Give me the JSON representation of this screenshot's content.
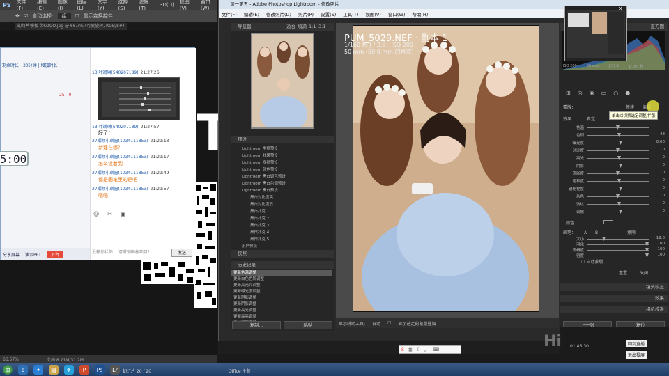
{
  "photoshop": {
    "logo": "PS",
    "menu": [
      "文件(F)",
      "编辑(E)",
      "图像(I)",
      "图层(L)",
      "文字(Y)",
      "选择(S)",
      "滤镜(T)",
      "3D(D)",
      "视图(V)",
      "窗口(W)"
    ],
    "options": {
      "auto_select": "自动选择:",
      "group": "组",
      "show_transform": "显示变换控件"
    },
    "tab": "幻灯片模板 带LOGO.jpg @ 66.7% (可变旋转, RGB/8#) *",
    "status_zoom": "66.67%",
    "status_doc": "文档:8.21M/31.2M",
    "big_letter": "T"
  },
  "chat": {
    "duration": "剩余时长：30分钟 | 增加时长",
    "badges": [
      "25",
      "0"
    ],
    "clock": "5:00",
    "bottom": {
      "share": "分享屏幕",
      "ppt": "演示PPT",
      "leave": "下台"
    },
    "messages": [
      {
        "user": "13 叶斌琳(540207189)",
        "time": "21:27:26",
        "text": "",
        "color": "orange"
      },
      {
        "user": "13 叶斌琳(540207189)",
        "time": "21:27:57",
        "text": "好了！",
        "color": "black"
      },
      {
        "user": "27姻颜小瑛窗(1034111853)",
        "time": "21:29:13",
        "text": "新建在哪？",
        "color": "orange"
      },
      {
        "user": "27姻颜小瑛窗(1034111853)",
        "time": "21:29:17",
        "text": "怎么设着到",
        "color": "orange"
      },
      {
        "user": "27姻颜小瑛窗(1034111853)",
        "time": "21:29:49",
        "text": "都是画笔里的是吧",
        "color": "orange"
      },
      {
        "user": "27姻颜小瑛窗(1034111853)",
        "time": "21:29:57",
        "text": "嗯嗯",
        "color": "orange"
      }
    ],
    "input_placeholder": "没被你拦你… 请撤销图标项目！",
    "send": "发送"
  },
  "lightroom": {
    "title": "课一第五 - Adobe Photoshop Lightroom - 修改照片",
    "menu": [
      "文件(F)",
      "编辑(E)",
      "修改照片(D)",
      "照片(P)",
      "设置(S)",
      "工具(T)",
      "视图(V)",
      "窗口(W)",
      "帮助(H)"
    ],
    "navigator": {
      "title": "导航器",
      "fit": "适合",
      "fill": "填满",
      "ratio": "1:1",
      "ratio2": "3:1"
    },
    "presets_title": "预设",
    "presets": [
      "Lightroom 常规预设",
      "Lightroom 效果预设",
      "Lightroom 视频预设",
      "Lightroom 颜色预设",
      "Lightroom 黑白调色预设",
      "Lightroom 黑白色调预设",
      "Lightroom 黑白预设"
    ],
    "sub_presets": [
      "黑白对比度高",
      "黑白对比度低",
      "黑白扑克 1",
      "黑白扑克 2",
      "黑白扑克 3",
      "黑白扑克 4",
      "黑白扑克 5"
    ],
    "user_presets": "用户预设",
    "snapshots_title": "快照",
    "history_title": "历史记录",
    "history": [
      "更新色温调整",
      "更新白色色阶调整",
      "更新高光亮调整",
      "更新曝光度调整",
      "更新阴影调整",
      "更新阴影调整",
      "更新高光调整",
      "更新高亮调整",
      "添加画笔调整"
    ],
    "copy_btn": "复制...",
    "paste_btn": "粘贴",
    "photo_name": "PUM_5029.NEF · 副本 1",
    "photo_exif1": "1/160 秒 ƒ / 2.8，ISO 200",
    "photo_exif2": "50 mm (50.0 mm 的格式)",
    "toolbar": {
      "show": "显示辅助工具:",
      "auto": "自动",
      "selected": "显示选定的蒙版叠加"
    },
    "right": {
      "histogram_title": "直方图",
      "hist_readout": [
        "ISO 200",
        "50 mm",
        "ƒ / 3.2",
        "1/160 秒"
      ],
      "mask_label": "蒙版：",
      "mask_new": "新建",
      "mask_edit": "编辑",
      "effect_label": "效果：",
      "effect_value": "自定",
      "tooltip": "单击以切换选定调整/扩张",
      "adjustments": [
        {
          "label": "色温",
          "value": ""
        },
        {
          "label": "色调",
          "value": "-48"
        },
        {
          "label": "曝光度",
          "value": "0.00"
        },
        {
          "label": "对比度",
          "value": "0"
        },
        {
          "label": "高光",
          "value": "0"
        },
        {
          "label": "阴影",
          "value": "0"
        },
        {
          "label": "清晰度",
          "value": "0"
        },
        {
          "label": "饱和度",
          "value": "0"
        },
        {
          "label": "锐化程度",
          "value": "0"
        },
        {
          "label": "杂色",
          "value": "0"
        },
        {
          "label": "波纹",
          "value": "0"
        },
        {
          "label": "去朦",
          "value": "0"
        }
      ],
      "color_label": "颜色",
      "brush_label": "画笔：",
      "brush_a": "A",
      "brush_b": "B",
      "brush_erase": "擦除",
      "brush_rows": [
        {
          "label": "大小",
          "value": "19.0"
        },
        {
          "label": "羽化",
          "value": "100"
        },
        {
          "label": "流畅度",
          "value": "100"
        },
        {
          "label": "密度",
          "value": "100"
        }
      ],
      "auto_mask": "自动蒙版",
      "reset_btn": "重置",
      "close_btn": "关闭",
      "sections": [
        "镜头校正",
        "效果",
        "相机校准"
      ],
      "prev_btn": "上一张",
      "reset2_btn": "复位"
    }
  },
  "ime": {
    "label": "英"
  },
  "player": {
    "btn1": "回到直播",
    "btn2": "退出投屏",
    "time": "01:46:30"
  },
  "taskbar": {
    "slide": "幻灯片 20 / 20",
    "office": "Office 主题"
  },
  "watermark": "Hi"
}
